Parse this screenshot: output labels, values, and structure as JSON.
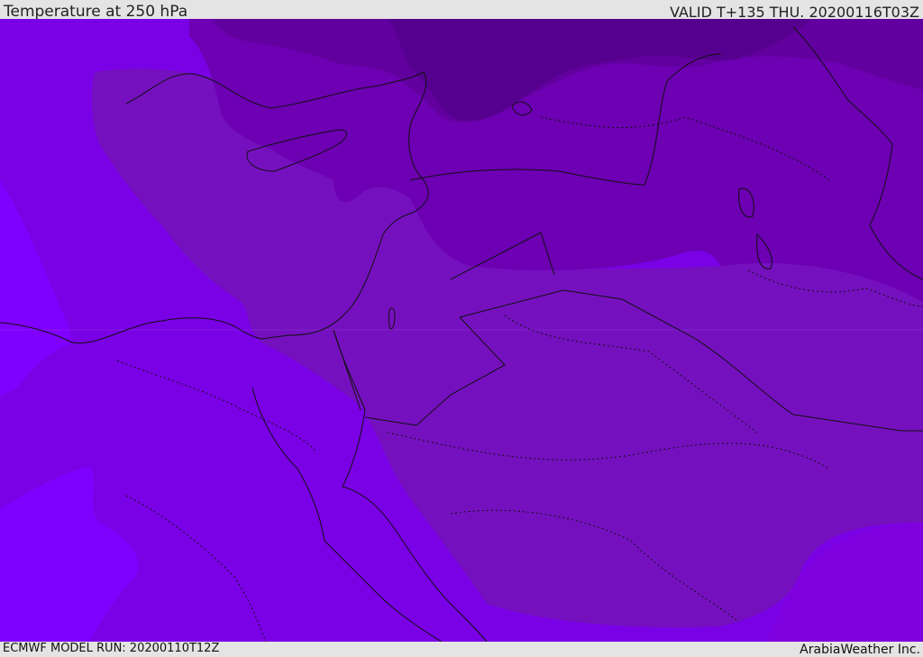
{
  "header": {
    "title": "Temperature at 250 hPa",
    "valid": "VALID T+135 THU. 20200116T03Z"
  },
  "footer": {
    "model_run": "ECMWF MODEL RUN: 20200110T12Z",
    "credit": "ArabiaWeather Inc."
  },
  "map": {
    "colors": {
      "background": "#7a00e6",
      "coldest": "#560090",
      "colder": "#62009f",
      "cold": "#6c00b2",
      "mid": "#7510bf",
      "warm": "#7f00df",
      "warmest": "#8000ff",
      "border": "#111111"
    }
  }
}
